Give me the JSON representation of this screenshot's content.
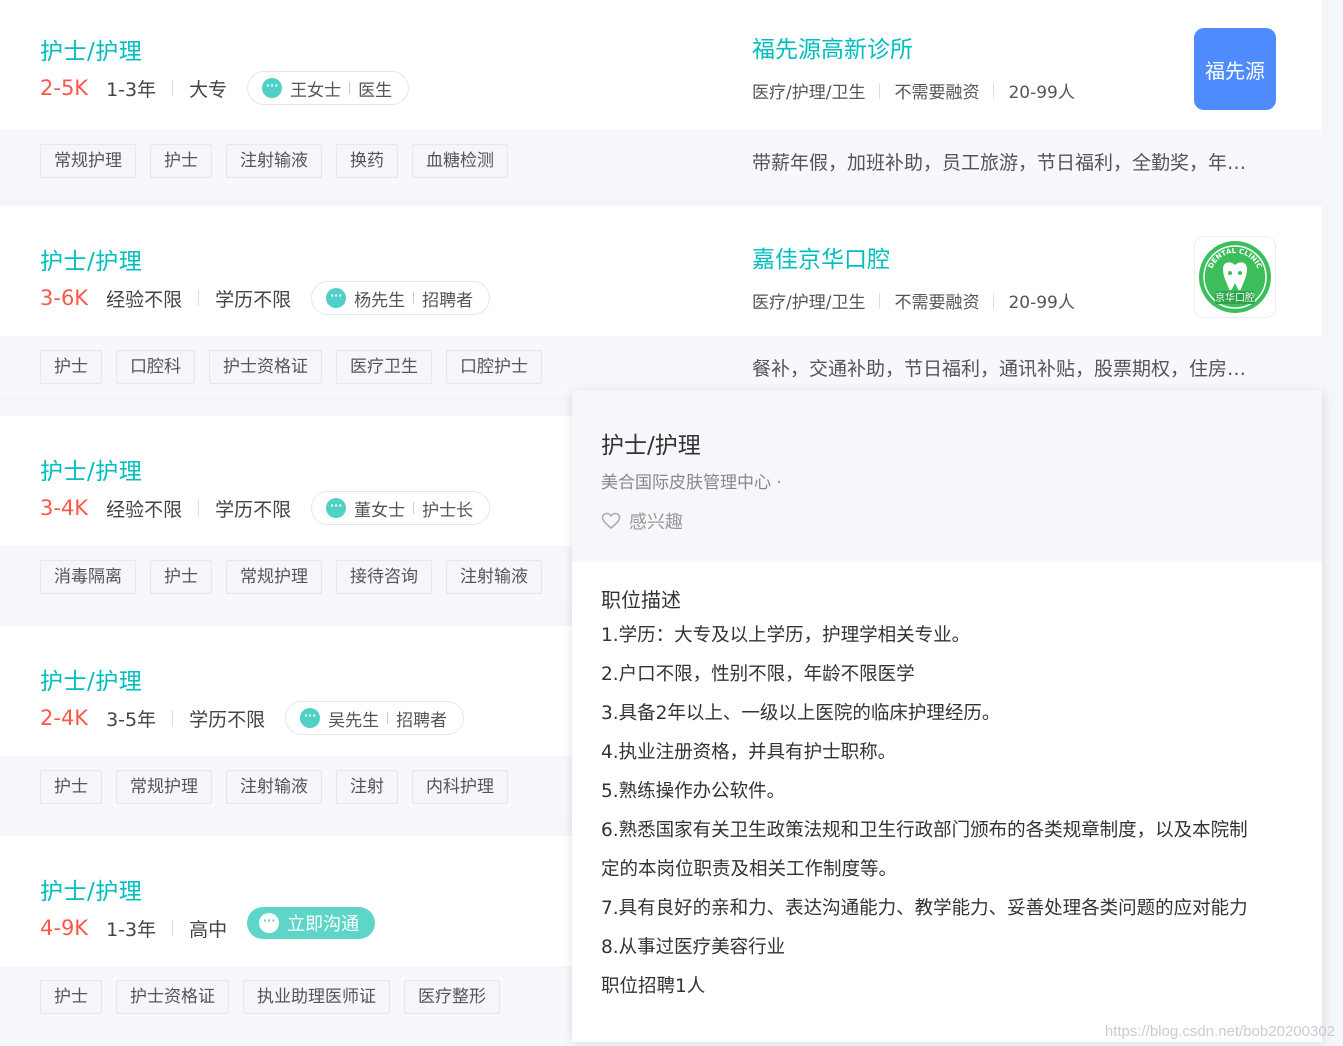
{
  "jobs": [
    {
      "title": "护士/护理",
      "salary": "2-5K",
      "experience": "1-3年",
      "education": "大专",
      "recruiter_name": "王女士",
      "recruiter_title": "医生",
      "tags": [
        "常规护理",
        "护士",
        "注射输液",
        "换药",
        "血糖检测"
      ],
      "company": {
        "name": "福先源高新诊所",
        "industry": "医疗/护理/卫生",
        "financing": "不需要融资",
        "size": "20-99人",
        "logo_text": "福先源",
        "benefits": "带薪年假，加班补助，员工旅游，节日福利，全勤奖，年…"
      }
    },
    {
      "title": "护士/护理",
      "salary": "3-6K",
      "experience": "经验不限",
      "education": "学历不限",
      "recruiter_name": "杨先生",
      "recruiter_title": "招聘者",
      "tags": [
        "护士",
        "口腔科",
        "护士资格证",
        "医疗卫生",
        "口腔护士"
      ],
      "company": {
        "name": "嘉佳京华口腔",
        "industry": "医疗/护理/卫生",
        "financing": "不需要融资",
        "size": "20-99人",
        "logo_text": "京华口腔",
        "logo_arc_text": "DENTAL CLINIC",
        "benefits": "餐补，交通补助，节日福利，通讯补贴，股票期权，住房…"
      }
    },
    {
      "title": "护士/护理",
      "salary": "3-4K",
      "experience": "经验不限",
      "education": "学历不限",
      "recruiter_name": "董女士",
      "recruiter_title": "护士长",
      "tags": [
        "消毒隔离",
        "护士",
        "常规护理",
        "接待咨询",
        "注射输液"
      ]
    },
    {
      "title": "护士/护理",
      "salary": "2-4K",
      "experience": "3-5年",
      "education": "学历不限",
      "recruiter_name": "吴先生",
      "recruiter_title": "招聘者",
      "tags": [
        "护士",
        "常规护理",
        "注射输液",
        "注射",
        "内科护理"
      ]
    },
    {
      "title": "护士/护理",
      "salary": "4-9K",
      "experience": "1-3年",
      "education": "高中",
      "chat_label": "立即沟通",
      "tags": [
        "护士",
        "护士资格证",
        "执业助理医师证",
        "医疗整形"
      ]
    }
  ],
  "popover": {
    "title": "护士/护理",
    "company": "美合国际皮肤管理中心 ·",
    "interest_label": "感兴趣",
    "desc_title": "职位描述",
    "lines": [
      "1.学历：大专及以上学历，护理学相关专业。",
      "2.户口不限，性别不限，年龄不限医学",
      "3.具备2年以上、一级以上医院的临床护理经历。",
      "4.执业注册资格，并具有护士职称。",
      "5.熟练操作办公软件。",
      "6.熟悉国家有关卫生政策法规和卫生行政部门颁布的各类规章制度，以及本院制",
      "定的本岗位职责及相关工作制度等。",
      "7.具有良好的亲和力、表达沟通能力、教学能力、妥善处理各类问题的应对能力",
      "8.从事过医疗美容行业",
      "职位招聘1人"
    ]
  },
  "watermark": "https://blog.csdn.net/bob20200302",
  "colors": {
    "accent": "#00bebd",
    "salary": "#fe574a",
    "logo_blue": "#4d8bff",
    "chat_green": "#5dd5c8"
  }
}
